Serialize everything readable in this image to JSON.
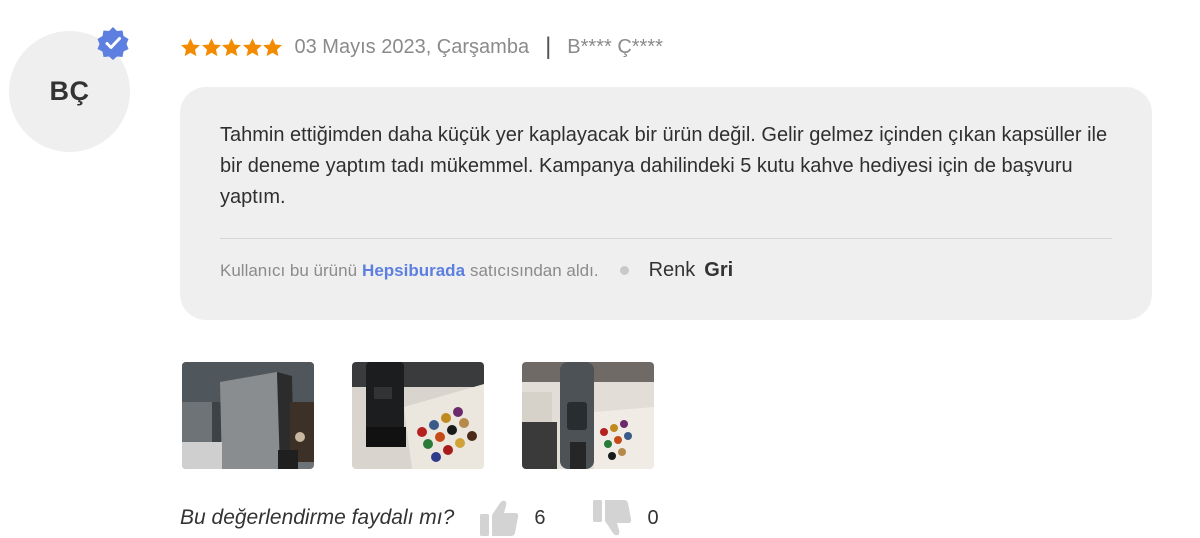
{
  "reviewer": {
    "initials": "BÇ",
    "masked_name": "B**** Ç****",
    "verified_icon": "verified-check-icon"
  },
  "review": {
    "rating": 5,
    "max_rating": 5,
    "date": "03 Mayıs 2023, Çarşamba",
    "separator": "|",
    "text": "Tahmin ettiğimden daha küçük yer kaplayacak bir ürün değil. Gelir gelmez içinden çıkan kapsüller ile bir deneme yaptım tadı mükemmel. Kampanya dahilindeki 5 kutu kahve hediyesi için de başvuru yaptım.",
    "purchase_prefix": "Kullanıcı bu ürünü",
    "seller": "Hepsiburada",
    "purchase_suffix": "satıcısından aldı.",
    "attribute_name": "Renk",
    "attribute_value": "Gri"
  },
  "photos": [
    "review-photo-1",
    "review-photo-2",
    "review-photo-3"
  ],
  "helpful": {
    "question": "Bu değerlendirme faydalı mı?",
    "likes": "6",
    "dislikes": "0"
  },
  "colors": {
    "star": "#f28b00",
    "verified": "#5c7fe0",
    "seller_link": "#5c7fe0",
    "bubble": "#efefef"
  }
}
